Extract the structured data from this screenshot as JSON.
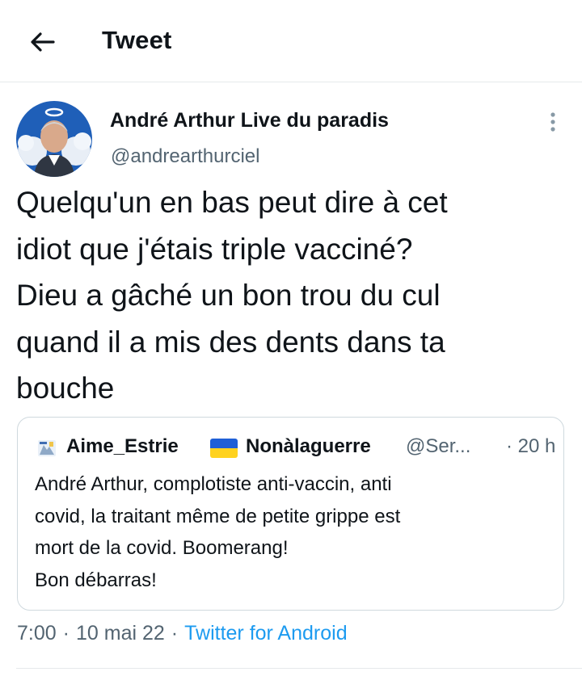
{
  "header": {
    "title": "Tweet",
    "back_icon": "arrow-left-icon"
  },
  "tweet": {
    "author_name": "André Arthur Live du paradis",
    "author_handle": "@andrearthurciel",
    "text": "Quelqu'un en bas peut dire à cet\nidiot que j'étais triple vacciné?\nDieu a gâché un bon trou du cul\nquand il a mis des dents dans ta\nbouche",
    "time": "7:00",
    "date": "10 mai 22",
    "source": "Twitter for Android"
  },
  "quote": {
    "name": "Aime_Estrie",
    "name2": "Nonàlaguerre",
    "handle": "@Ser...",
    "time": "· 20 h",
    "text": "André Arthur, complotiste anti-vaccin, anti\ncovid, la traitant même de petite grippe est\nmort de la covid. Boomerang!\nBon débarras!"
  },
  "meta": {
    "separator": "·"
  },
  "colors": {
    "accent": "#1d9bf0",
    "secondary_text": "#536471",
    "border": "#cfd9de"
  }
}
